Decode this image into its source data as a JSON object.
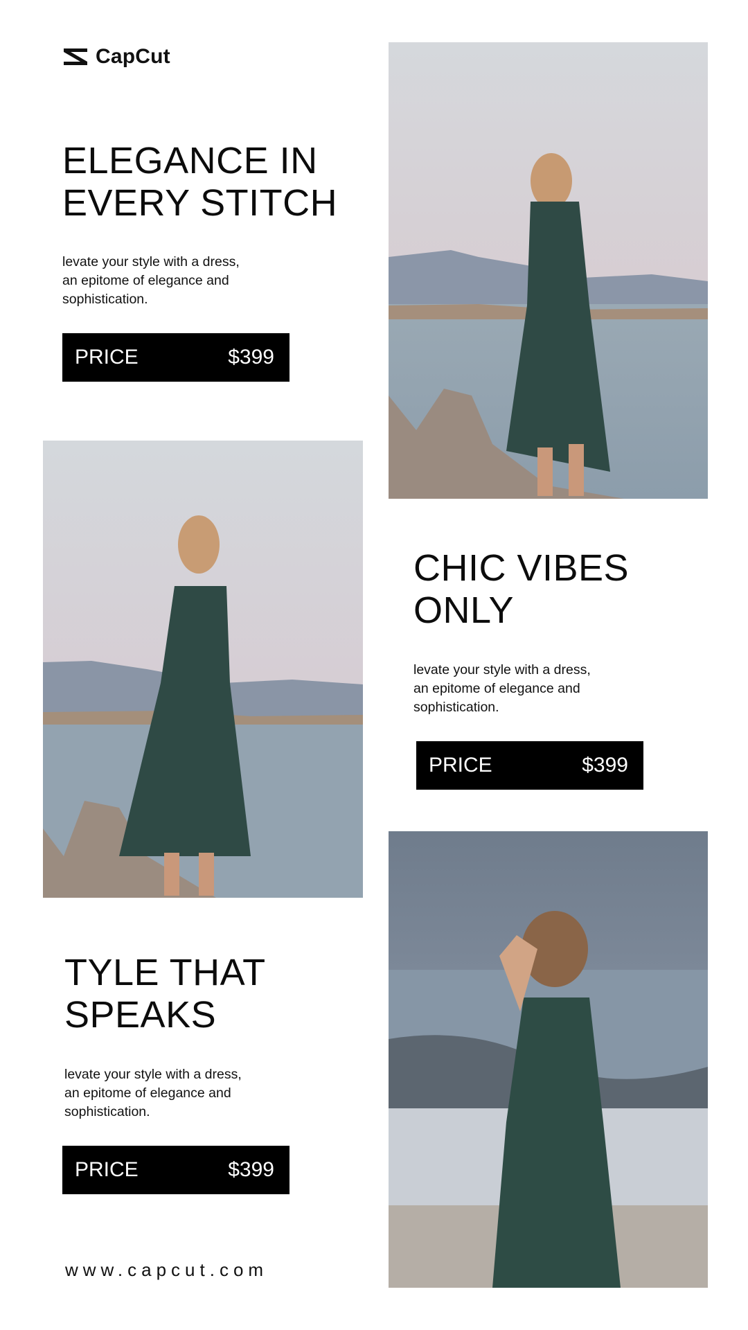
{
  "brand": {
    "name": "CapCut"
  },
  "sections": [
    {
      "headline_line1": "ELEGANCE IN",
      "headline_line2": "EVERY STITCH",
      "description_line1": "levate your style with a dress,",
      "description_line2": "an epitome of elegance and",
      "description_line3": "sophistication.",
      "price_label": "PRICE",
      "price_value": "$399"
    },
    {
      "headline_line1": "CHIC VIBES",
      "headline_line2": "ONLY",
      "description_line1": "levate your style with a dress,",
      "description_line2": "an epitome of elegance and",
      "description_line3": "sophistication.",
      "price_label": "PRICE",
      "price_value": "$399"
    },
    {
      "headline_line1": "TYLE THAT",
      "headline_line2": "SPEAKS",
      "description_line1": "levate your style with a dress,",
      "description_line2": "an epitome of elegance and",
      "description_line3": "sophistication.",
      "price_label": "PRICE",
      "price_value": "$399"
    }
  ],
  "footer": {
    "url": "www.capcut.com"
  },
  "colors": {
    "background": "#ffffff",
    "price_bar": "#000000",
    "dress": "#2f4a45",
    "sea": "#8ea0ae",
    "sky": "#d9d7dc"
  }
}
